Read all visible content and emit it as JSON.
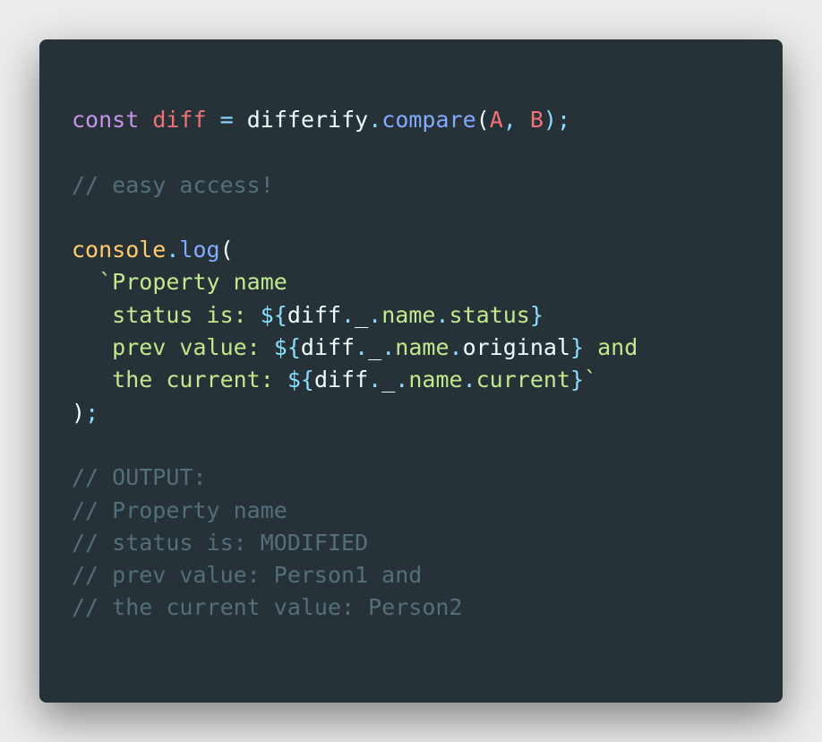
{
  "code": {
    "colors": {
      "background": "#263238",
      "keyword": "#c792ea",
      "variable": "#f07178",
      "operator": "#89ddff",
      "plain": "#eeffff",
      "function": "#82aaff",
      "punctuation": "#89ddff",
      "comment": "#546e7a",
      "object": "#ffcb6b",
      "string": "#c3e88d"
    },
    "lines": [
      [
        {
          "text": "const",
          "t": "keyword"
        },
        {
          "text": " ",
          "t": "plain"
        },
        {
          "text": "diff",
          "t": "variable"
        },
        {
          "text": " ",
          "t": "plain"
        },
        {
          "text": "=",
          "t": "operator"
        },
        {
          "text": " ",
          "t": "plain"
        },
        {
          "text": "differify",
          "t": "plain"
        },
        {
          "text": ".",
          "t": "punctuation"
        },
        {
          "text": "compare",
          "t": "function"
        },
        {
          "text": "(",
          "t": "plain"
        },
        {
          "text": "A",
          "t": "variable"
        },
        {
          "text": ", ",
          "t": "punctuation"
        },
        {
          "text": "B",
          "t": "variable"
        },
        {
          "text": ");",
          "t": "punctuation"
        }
      ],
      [],
      [
        {
          "text": "// easy access!",
          "t": "comment"
        }
      ],
      [],
      [
        {
          "text": "console",
          "t": "object"
        },
        {
          "text": ".",
          "t": "punctuation"
        },
        {
          "text": "log",
          "t": "function"
        },
        {
          "text": "(",
          "t": "plain"
        }
      ],
      [
        {
          "text": "  ",
          "t": "plain"
        },
        {
          "text": "`",
          "t": "string"
        },
        {
          "text": "Property name",
          "t": "string"
        }
      ],
      [
        {
          "text": "   status is: ",
          "t": "string"
        },
        {
          "text": "${",
          "t": "operator"
        },
        {
          "text": "diff",
          "t": "plain"
        },
        {
          "text": ".",
          "t": "punctuation"
        },
        {
          "text": "_",
          "t": "plain"
        },
        {
          "text": ".",
          "t": "punctuation"
        },
        {
          "text": "name",
          "t": "string"
        },
        {
          "text": ".",
          "t": "punctuation"
        },
        {
          "text": "status",
          "t": "string"
        },
        {
          "text": "}",
          "t": "operator"
        }
      ],
      [
        {
          "text": "   prev value: ",
          "t": "string"
        },
        {
          "text": "${",
          "t": "operator"
        },
        {
          "text": "diff",
          "t": "plain"
        },
        {
          "text": ".",
          "t": "punctuation"
        },
        {
          "text": "_",
          "t": "plain"
        },
        {
          "text": ".",
          "t": "punctuation"
        },
        {
          "text": "name",
          "t": "string"
        },
        {
          "text": ".",
          "t": "punctuation"
        },
        {
          "text": "original",
          "t": "plain"
        },
        {
          "text": "}",
          "t": "operator"
        },
        {
          "text": " and",
          "t": "string"
        }
      ],
      [
        {
          "text": "   the current: ",
          "t": "string"
        },
        {
          "text": "${",
          "t": "operator"
        },
        {
          "text": "diff",
          "t": "plain"
        },
        {
          "text": ".",
          "t": "punctuation"
        },
        {
          "text": "_",
          "t": "plain"
        },
        {
          "text": ".",
          "t": "punctuation"
        },
        {
          "text": "name",
          "t": "string"
        },
        {
          "text": ".",
          "t": "punctuation"
        },
        {
          "text": "current",
          "t": "string"
        },
        {
          "text": "}",
          "t": "operator"
        },
        {
          "text": "`",
          "t": "string"
        }
      ],
      [
        {
          "text": ")",
          "t": "plain"
        },
        {
          "text": ";",
          "t": "punctuation"
        }
      ],
      [],
      [
        {
          "text": "// OUTPUT:",
          "t": "comment"
        }
      ],
      [
        {
          "text": "// Property name",
          "t": "comment"
        }
      ],
      [
        {
          "text": "// status is: MODIFIED",
          "t": "comment"
        }
      ],
      [
        {
          "text": "// prev value: Person1 and",
          "t": "comment"
        }
      ],
      [
        {
          "text": "// the current value: Person2",
          "t": "comment"
        }
      ]
    ]
  }
}
